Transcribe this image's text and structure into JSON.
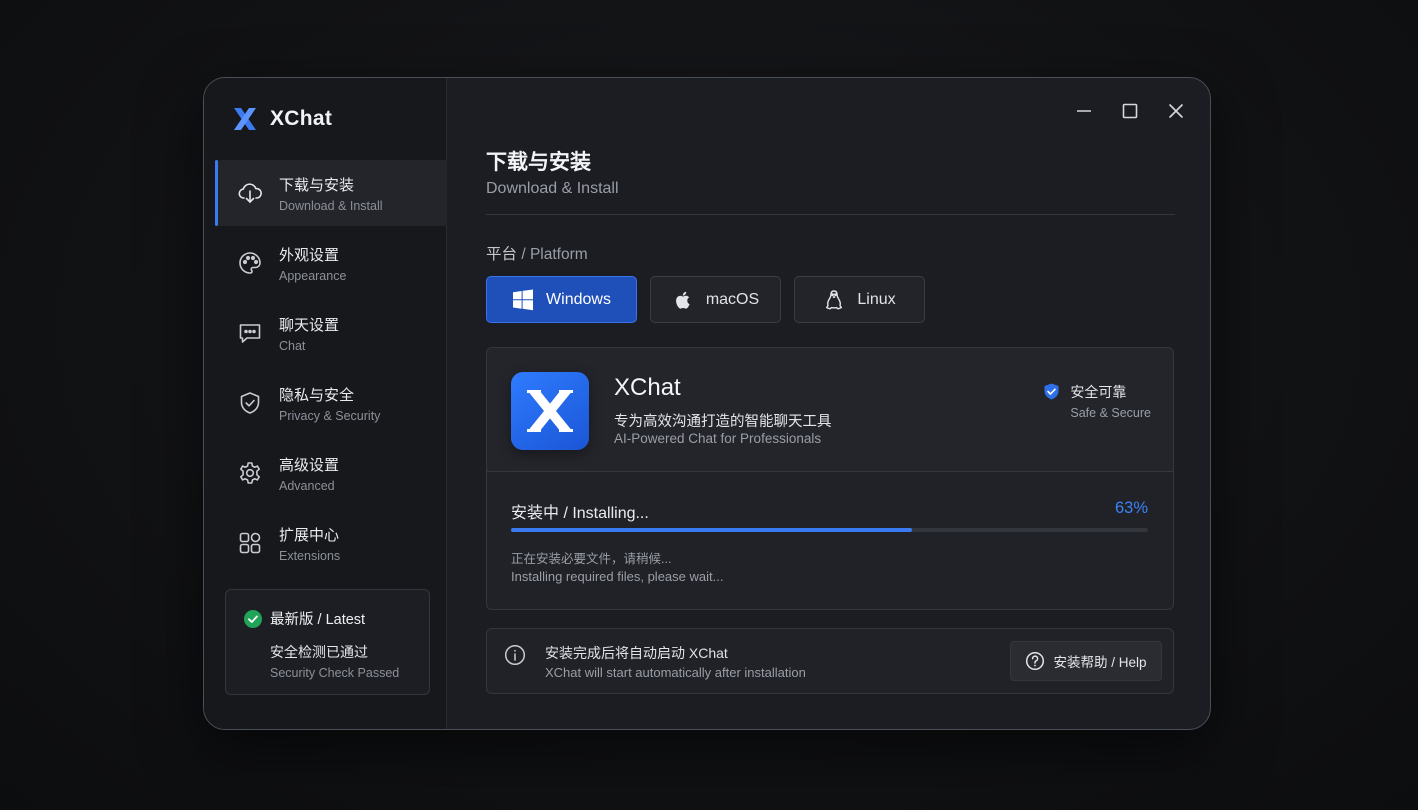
{
  "app": {
    "name": "XChat",
    "accent": "#3b7bf2"
  },
  "sidebar": {
    "items": [
      {
        "zh": "下载与安装",
        "en": "Download & Install",
        "icon": "cloud-download-icon",
        "active": true
      },
      {
        "zh": "外观设置",
        "en": "Appearance",
        "icon": "palette-icon"
      },
      {
        "zh": "聊天设置",
        "en": "Chat",
        "icon": "chat-bubble-icon"
      },
      {
        "zh": "隐私与安全",
        "en": "Privacy & Security",
        "icon": "shield-icon"
      },
      {
        "zh": "高级设置",
        "en": "Advanced",
        "icon": "gear-icon"
      },
      {
        "zh": "扩展中心",
        "en": "Extensions",
        "icon": "grid-apps-icon"
      }
    ],
    "latest": {
      "title": "最新版 / Latest",
      "check_zh": "安全检测已通过",
      "check_en": "Security Check Passed",
      "status_color": "#22a35a"
    }
  },
  "main": {
    "title": "下载与安装",
    "subtitle": "Download & Install",
    "platform_label_zh": "平台",
    "platform_label_en": "/ Platform",
    "platforms": [
      {
        "label": "Windows",
        "icon": "windows-icon",
        "selected": true
      },
      {
        "label": "macOS",
        "icon": "apple-icon",
        "selected": false
      },
      {
        "label": "Linux",
        "icon": "linux-penguin-icon",
        "selected": false
      }
    ],
    "card": {
      "name": "XChat",
      "tagline_zh": "专为高效沟通打造的智能聊天工具",
      "tagline_en": "AI-Powered Chat for Professionals",
      "safe_zh": "安全可靠",
      "safe_en": "Safe & Secure"
    },
    "progress": {
      "label": "安装中 / Installing...",
      "percent_text": "63%",
      "percent": 63,
      "note_zh": "正在安装必要文件，请稍候...",
      "note_en": "Installing required files, please wait..."
    },
    "info": {
      "zh": "安装完成后将自动启动 XChat",
      "en": "XChat will start automatically after installation",
      "help": "安装帮助 / Help"
    }
  }
}
